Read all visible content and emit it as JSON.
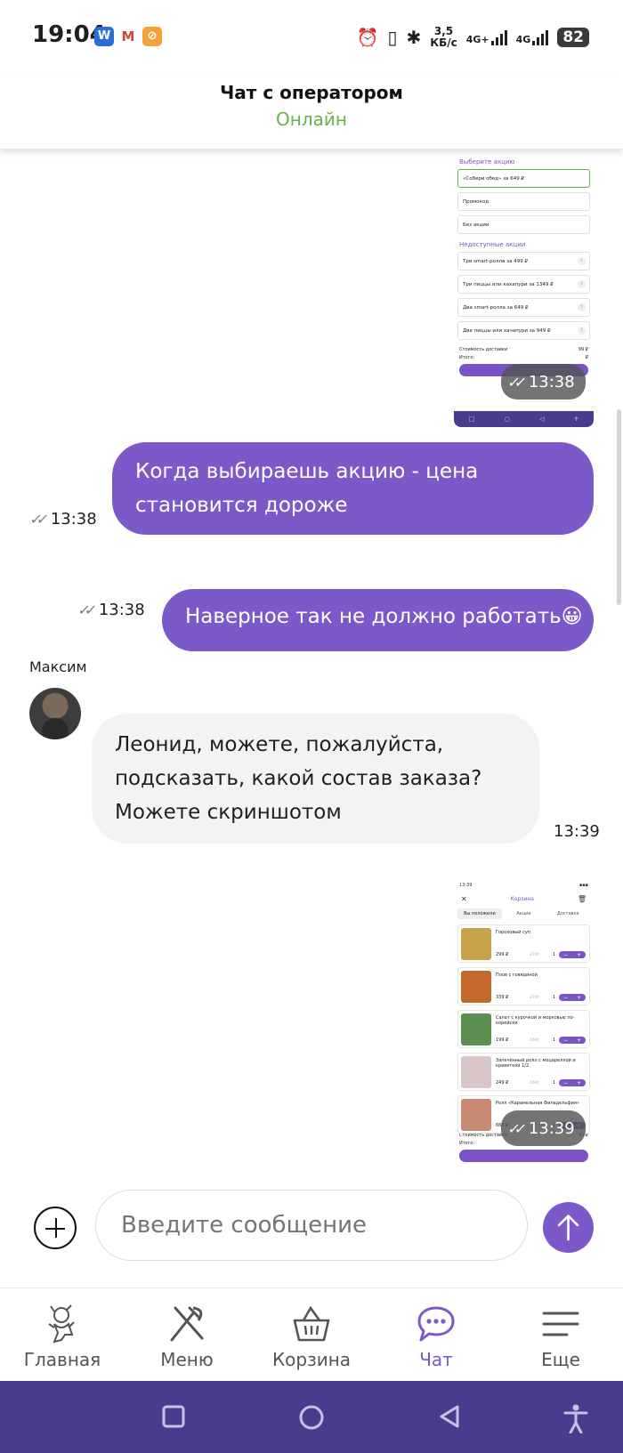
{
  "status_bar": {
    "time": "19:04",
    "speed_value": "3,5",
    "speed_unit": "КБ/с",
    "net1": "4G+",
    "net2": "4G",
    "battery": "82"
  },
  "header": {
    "title": "Чат с оператором",
    "status": "Онлайн",
    "status_color": "#6ab04c"
  },
  "messages": [
    {
      "kind": "image",
      "time": "13:38",
      "screenshot": {
        "section1": "Выберите акцию",
        "options": [
          "«Собери обед» за 649 ₽",
          "Промокод",
          "Без акции"
        ],
        "section2": "Недоступные акции",
        "unavailable": [
          "Три smart-ролла за 499 ₽",
          "Три пиццы или кахапури за 1349 ₽",
          "Два smart-ролла за 649 ₽",
          "Две пиццы или хачапури за 949 ₽"
        ],
        "delivery_label": "Стоимость доставки",
        "delivery_value": "99 ₽",
        "total_label": "Итого:",
        "total_value": "₽"
      }
    },
    {
      "kind": "outgoing",
      "text": "Когда выбираешь акцию - цена становится дороже",
      "time": "13:38"
    },
    {
      "kind": "outgoing",
      "text": "Наверное так не должно работать😀",
      "time": "13:38"
    },
    {
      "kind": "incoming",
      "sender": "Максим",
      "text": "Леонид, можете, пожалуйста, подсказать, какой состав заказа? Можете скриншотом",
      "time": "13:39"
    },
    {
      "kind": "image",
      "time": "13:39",
      "screenshot": {
        "status_time": "13:39",
        "title": "Корзина",
        "tabs": [
          "Вы положили",
          "Акции",
          "Доставка"
        ],
        "items": [
          {
            "name": "Гороховый суп",
            "price": "299 ₽",
            "weight": "270г",
            "qty": "1",
            "color": "#c8a24a"
          },
          {
            "name": "Плов с говядиной",
            "price": "339 ₽",
            "weight": "270г",
            "qty": "1",
            "color": "#c4692c"
          },
          {
            "name": "Салат с курочкой и морковью по-корейски",
            "price": "199 ₽",
            "weight": "160г",
            "qty": "1",
            "color": "#5b8f4f"
          },
          {
            "name": "Запечённый ролл с моцареллой и креветкой 1/2",
            "price": "249 ₽",
            "weight": "160г",
            "qty": "1",
            "color": "#d9c6c9"
          },
          {
            "name": "Ролл «Карамельная Филадельфия»",
            "price": "669 ₽",
            "weight": "160г",
            "qty": "1",
            "color": "#c98a73"
          }
        ],
        "delivery_label": "Стоимость доставки",
        "delivery_value": "99 ₽",
        "total_label": "Итого:"
      }
    }
  ],
  "composer": {
    "placeholder": "Введите сообщение"
  },
  "tabs": [
    {
      "label": "Главная",
      "icon": "mascot-icon",
      "active": false
    },
    {
      "label": "Меню",
      "icon": "fork-knife-icon",
      "active": false
    },
    {
      "label": "Корзина",
      "icon": "basket-icon",
      "active": false
    },
    {
      "label": "Чат",
      "icon": "chat-bubble-icon",
      "active": true
    },
    {
      "label": "Еще",
      "icon": "menu-lines-icon",
      "active": false
    }
  ],
  "colors": {
    "accent": "#7b59c8",
    "nav_bar": "#4a3b8c",
    "incoming_bubble": "#f3f3f3"
  }
}
